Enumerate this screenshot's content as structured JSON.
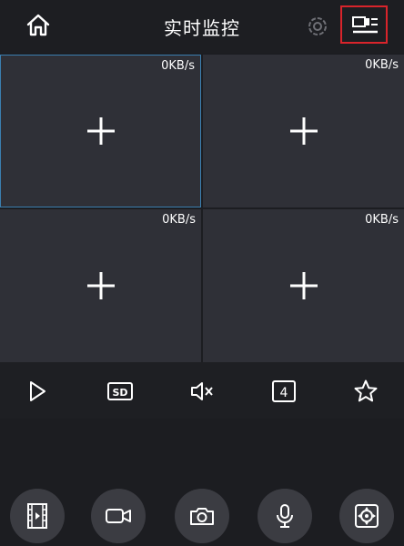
{
  "header": {
    "title": "实时监控",
    "home_icon": "home-icon",
    "settings_icon": "gear-icon",
    "layout_icon": "screen-layout-icon",
    "highlight_color": "#d9242b"
  },
  "grid": {
    "cells": [
      {
        "speed": "0KB/s",
        "selected": true
      },
      {
        "speed": "0KB/s",
        "selected": false
      },
      {
        "speed": "0KB/s",
        "selected": false
      },
      {
        "speed": "0KB/s",
        "selected": false
      }
    ],
    "add_icon": "plus-icon",
    "selected_border_color": "#3b7fb0"
  },
  "toolbar": {
    "items": [
      "play-icon",
      "sd-quality-icon",
      "mute-icon",
      "split-4-icon",
      "favorite-star-icon"
    ],
    "sd_label": "SD",
    "split_label": "4"
  },
  "actions": {
    "items": [
      "playback-icon",
      "record-video-icon",
      "snapshot-camera-icon",
      "talk-microphone-icon",
      "ptz-control-icon"
    ]
  }
}
